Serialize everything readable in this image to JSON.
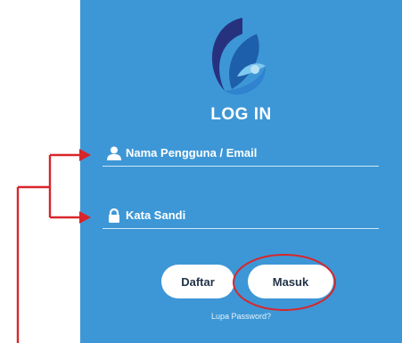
{
  "login": {
    "title": "LOG IN",
    "username_placeholder": "Nama Pengguna / Email",
    "username_value": "",
    "password_placeholder": "Kata Sandi",
    "password_value": "",
    "register_button": "Daftar",
    "login_button": "Masuk",
    "forgot_link": "Lupa Password?"
  },
  "icons": {
    "logo": "app-logo-icon",
    "username": "user-icon",
    "password": "lock-icon"
  },
  "colors": {
    "panel": "#3d97d6",
    "annotation_arrow": "#d8262b",
    "highlight_circle": "#d8262b",
    "button_text": "#233447"
  }
}
